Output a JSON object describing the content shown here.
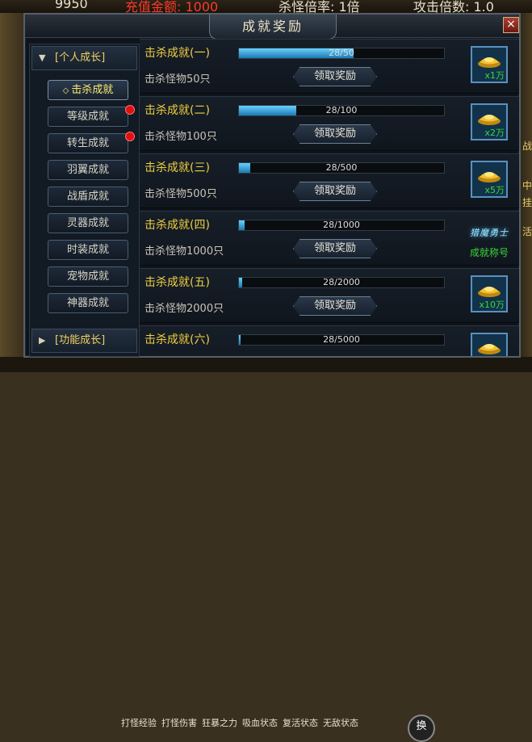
{
  "hud": {
    "value_left": "9950",
    "gold_label": "充值金额: 1000",
    "rate_label": "杀怪倍率: 1倍",
    "attack_label": "攻击倍数: 1.0"
  },
  "panel": {
    "title": "成就奖励",
    "close": "×"
  },
  "sidebar": {
    "personal_header": "[个人成长]",
    "function_header": "[功能成长]",
    "items": [
      {
        "label": "击杀成就",
        "active": true,
        "dot": false
      },
      {
        "label": "等级成就",
        "active": false,
        "dot": true
      },
      {
        "label": "转生成就",
        "active": false,
        "dot": true
      },
      {
        "label": "羽翼成就",
        "active": false,
        "dot": false
      },
      {
        "label": "战盾成就",
        "active": false,
        "dot": false
      },
      {
        "label": "灵器成就",
        "active": false,
        "dot": false
      },
      {
        "label": "时装成就",
        "active": false,
        "dot": false
      },
      {
        "label": "宠物成就",
        "active": false,
        "dot": false
      },
      {
        "label": "神器成就",
        "active": false,
        "dot": false
      }
    ]
  },
  "claim_label": "领取奖励",
  "achievements": [
    {
      "title": "击杀成就(一)",
      "desc": "击杀怪物50只",
      "progress": "28/50",
      "ratio": 0.56,
      "reward_type": "gold",
      "reward_qty": "x1万"
    },
    {
      "title": "击杀成就(二)",
      "desc": "击杀怪物100只",
      "progress": "28/100",
      "ratio": 0.28,
      "reward_type": "gold",
      "reward_qty": "x2万"
    },
    {
      "title": "击杀成就(三)",
      "desc": "击杀怪物500只",
      "progress": "28/500",
      "ratio": 0.056,
      "reward_type": "gold",
      "reward_qty": "x5万"
    },
    {
      "title": "击杀成就(四)",
      "desc": "击杀怪物1000只",
      "progress": "28/1000",
      "ratio": 0.028,
      "reward_type": "title",
      "reward_emblem": "猎魔勇士",
      "reward_name": "成就称号"
    },
    {
      "title": "击杀成就(五)",
      "desc": "击杀怪物2000只",
      "progress": "28/2000",
      "ratio": 0.014,
      "reward_type": "gold",
      "reward_qty": "x10万"
    },
    {
      "title": "击杀成就(六)",
      "desc": "",
      "progress": "28/5000",
      "ratio": 0.0056,
      "reward_type": "gold",
      "reward_qty": ""
    }
  ],
  "bottom_bar": [
    "打怪经验",
    "打怪伤害",
    "狂暴之力",
    "吸血状态",
    "复活状态",
    "无敌状态"
  ],
  "side_texts": [
    "战",
    "中",
    "挂",
    "活"
  ],
  "round_button": "换",
  "colors": {
    "gold_text": "#f0d040",
    "progress": "#2a9ad8",
    "reward_qty": "#3ad83a",
    "alert_dot": "#e01010"
  }
}
